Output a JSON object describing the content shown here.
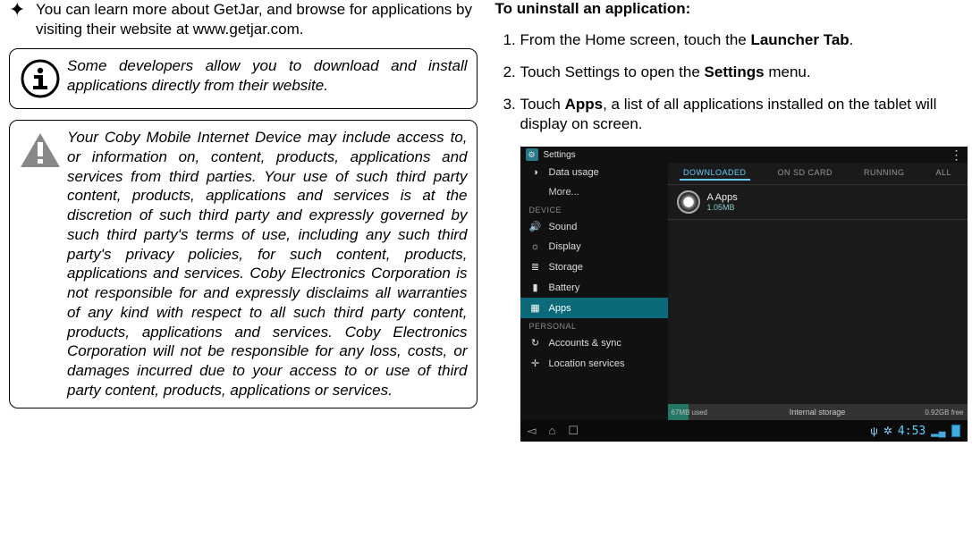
{
  "left": {
    "bullet_glyph": "✦",
    "bullet_text": "You can learn more about GetJar, and browse for applications by visiting their website at www.getjar.com.",
    "note_text": "Some developers allow you to download and install applications directly from their website.",
    "warn_text": "Your Coby Mobile Internet Device may include access to, or information on, content, products, applications and services from third parties. Your use of such third party content, products, applications and services is at the discretion of such third party and expressly governed by such third party's terms of use, including any such third party's privacy policies, for such content, products, applications and services. Coby Electronics Corporation is not responsible for and expressly disclaims all warranties of any kind with respect to all such third party content, products, applications and services. Coby Electronics Corporation will not be responsible for any loss, costs, or damages incurred due to your access to or use of third party content, products, applications or services."
  },
  "right": {
    "heading": "To uninstall an application:",
    "step1_pre": "From the Home screen, touch the ",
    "step1_b": "Launcher Tab",
    "step1_post": ".",
    "step2_pre": "Touch Settings to open the ",
    "step2_b": "Settings",
    "step2_post": " menu.",
    "step3_pre": "Touch ",
    "step3_b": "Apps",
    "step3_post": ", a list of all applications installed on the tablet will display on screen."
  },
  "shot": {
    "title": "Settings",
    "side_items": {
      "data_usage": "Data usage",
      "more": "More...",
      "section_device": "DEVICE",
      "sound": "Sound",
      "display": "Display",
      "storage": "Storage",
      "battery": "Battery",
      "apps": "Apps",
      "section_personal": "PERSONAL",
      "accounts": "Accounts & sync",
      "location": "Location services"
    },
    "tabs": {
      "downloaded": "DOWNLOADED",
      "on_sd": "ON SD CARD",
      "running": "RUNNING",
      "all": "ALL"
    },
    "app": {
      "name": "A Apps",
      "size": "1.05MB"
    },
    "storage": {
      "label": "Internal storage",
      "used": "67MB used",
      "free": "0.92GB free"
    },
    "clock": "4:53"
  }
}
